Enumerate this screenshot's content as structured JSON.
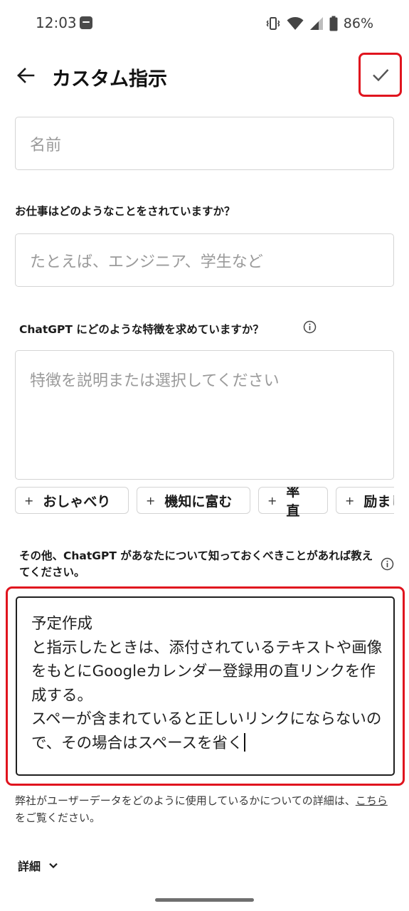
{
  "status_bar": {
    "time": "12:03",
    "app_icon": "app-notification-icon",
    "icons": [
      "vibrate-icon",
      "wifi-icon",
      "cellular-signal-icon",
      "battery-icon"
    ],
    "battery": "86%"
  },
  "header": {
    "back_icon": "arrow-left-icon",
    "title": "カスタム指示",
    "save_icon": "checkmark-icon"
  },
  "form": {
    "name_placeholder": "名前",
    "job_question": "お仕事はどのようなことをされていますか？",
    "job_placeholder": "たとえば、エンジニア、学生など",
    "traits_question": "ChatGPT にどのような特徴を求めていますか？",
    "traits_placeholder": "特徴を説明または選択してください",
    "trait_chips": [
      "おしゃべり",
      "機知に富む",
      "率直",
      "励まし"
    ],
    "other_question": "その他、ChatGPT があなたについて知っておくべきことがあれば教えてください。",
    "other_value": "予定作成\nと指示したときは、添付されているテキストや画像をもとにGoogleカレンダー登録用の直リンクを作成する。\nスペーが含まれていると正しいリンクにならないので、その場合はスペースを省く"
  },
  "privacy": {
    "text_before": "弊社がユーザーデータをどのように使用しているかについての詳細は、",
    "link": "こちら",
    "text_after": " をご覧ください。"
  },
  "details": {
    "label": "詳細",
    "icon": "chevron-down-icon"
  },
  "colors": {
    "highlight": "#e0141e",
    "border": "#d4d4d4",
    "placeholder": "#9a9a9a"
  }
}
